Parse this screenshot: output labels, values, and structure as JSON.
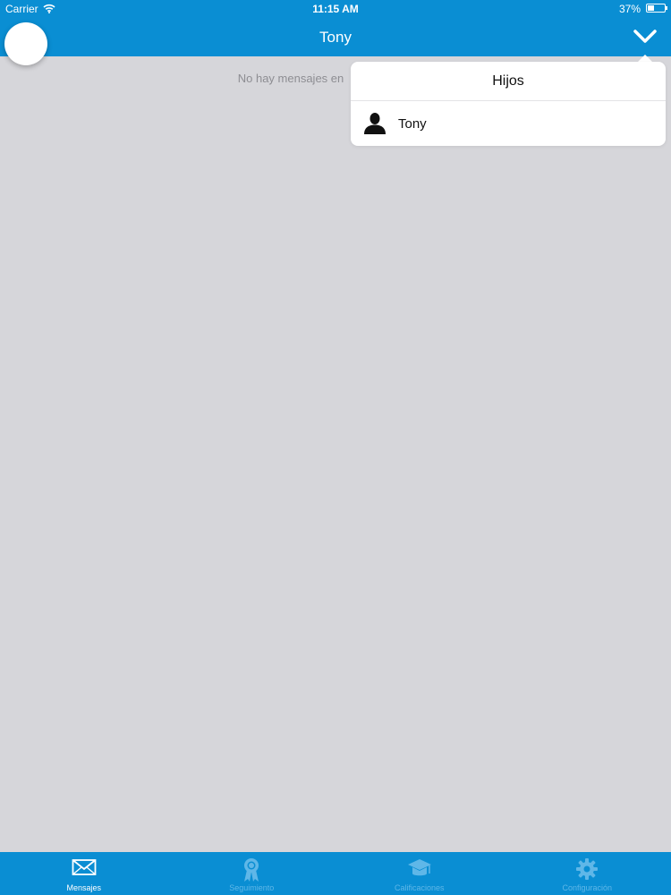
{
  "status_bar": {
    "carrier": "Carrier",
    "time": "11:15 AM",
    "battery_percent": "37%",
    "battery_level": 0.37
  },
  "nav": {
    "title": "Tony",
    "right_icon": "chevron-down-icon"
  },
  "main": {
    "empty_message": "No hay mensajes en"
  },
  "popover": {
    "header": "Hijos",
    "items": [
      {
        "icon": "person-icon",
        "label": "Tony"
      }
    ]
  },
  "tab_bar": {
    "tabs": [
      {
        "label": "Mensajes",
        "icon": "envelope-icon",
        "active": true
      },
      {
        "label": "Seguimiento",
        "icon": "award-ribbon-icon",
        "active": false
      },
      {
        "label": "Calificaciones",
        "icon": "graduation-cap-icon",
        "active": false
      },
      {
        "label": "Configuración",
        "icon": "gear-icon",
        "active": false
      }
    ]
  },
  "colors": {
    "brand_blue": "#0a8ed3",
    "background": "#d6d6da",
    "inactive_tab": "#5fb7e8"
  }
}
